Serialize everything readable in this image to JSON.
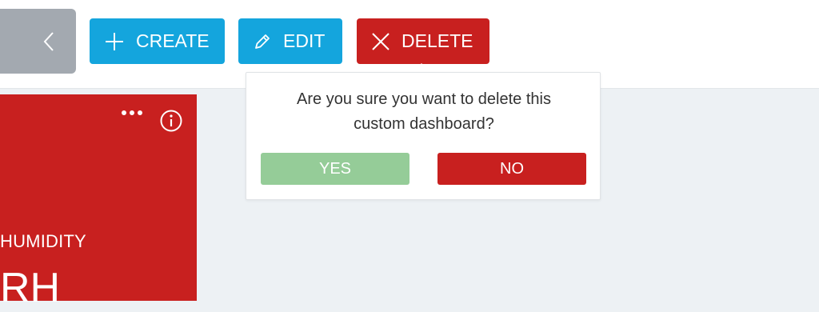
{
  "toolbar": {
    "back_icon": "chevron-left-icon",
    "create": {
      "label": "CREATE",
      "icon": "plus-icon"
    },
    "edit": {
      "label": "EDIT",
      "icon": "pencil-icon"
    },
    "delete": {
      "label": "DELETE",
      "icon": "close-icon"
    }
  },
  "card": {
    "label": "HUMIDITY",
    "value": "RH",
    "menu_icon": "more-horizontal-icon",
    "info_icon": "info-icon"
  },
  "popover": {
    "message_line1": "Are you sure you want to delete this",
    "message_line2": "custom dashboard?",
    "yes_label": "YES",
    "no_label": "NO"
  },
  "colors": {
    "primary_blue": "#14a5dd",
    "danger_red": "#c8201f",
    "confirm_green": "#95cc98",
    "back_gray": "#a3a9b0",
    "page_bg": "#edf1f4"
  }
}
